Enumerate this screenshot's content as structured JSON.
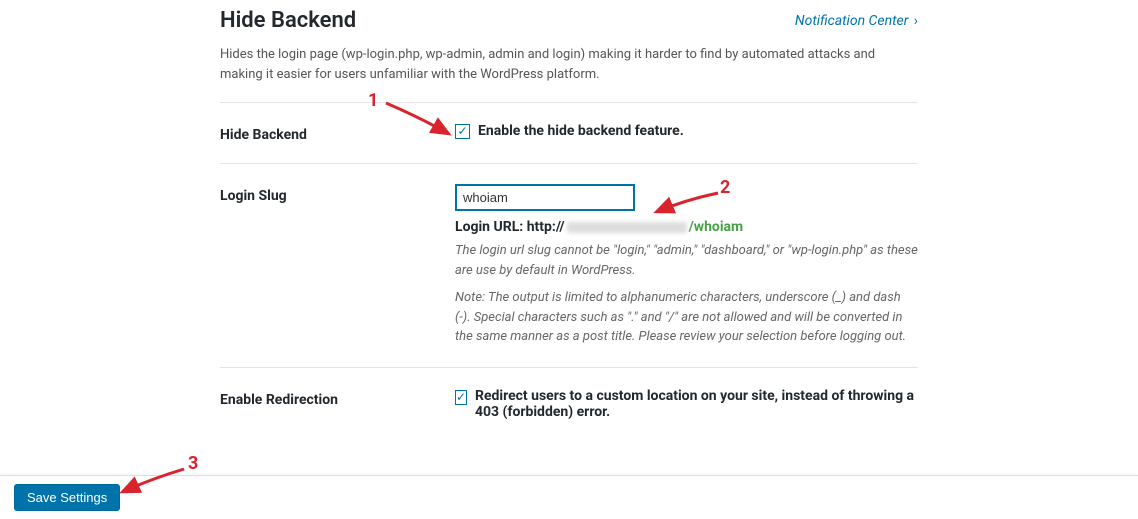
{
  "header": {
    "title": "Hide Backend",
    "notification_link": "Notification Center"
  },
  "intro": "Hides the login page (wp-login.php, wp-admin, admin and login) making it harder to find by automated attacks and making it easier for users unfamiliar with the WordPress platform.",
  "hide_backend": {
    "label": "Hide Backend",
    "checkbox_label": "Enable the hide backend feature."
  },
  "login_slug": {
    "label": "Login Slug",
    "value": "whoiam",
    "url_label": "Login URL: http://",
    "url_slug": "/whoiam",
    "desc1": "The login url slug cannot be \"login,\" \"admin,\" \"dashboard,\" or \"wp-login.php\" as these are use by default in WordPress.",
    "desc2": "Note: The output is limited to alphanumeric characters, underscore (_) and dash (-). Special characters such as \".\" and \"/\" are not allowed and will be converted in the same manner as a post title. Please review your selection before logging out."
  },
  "redirection": {
    "label": "Enable Redirection",
    "checkbox_label": "Redirect users to a custom location on your site, instead of throwing a 403 (forbidden) error."
  },
  "footer": {
    "save_label": "Save Settings"
  },
  "annotations": {
    "a1": "1",
    "a2": "2",
    "a3": "3"
  }
}
